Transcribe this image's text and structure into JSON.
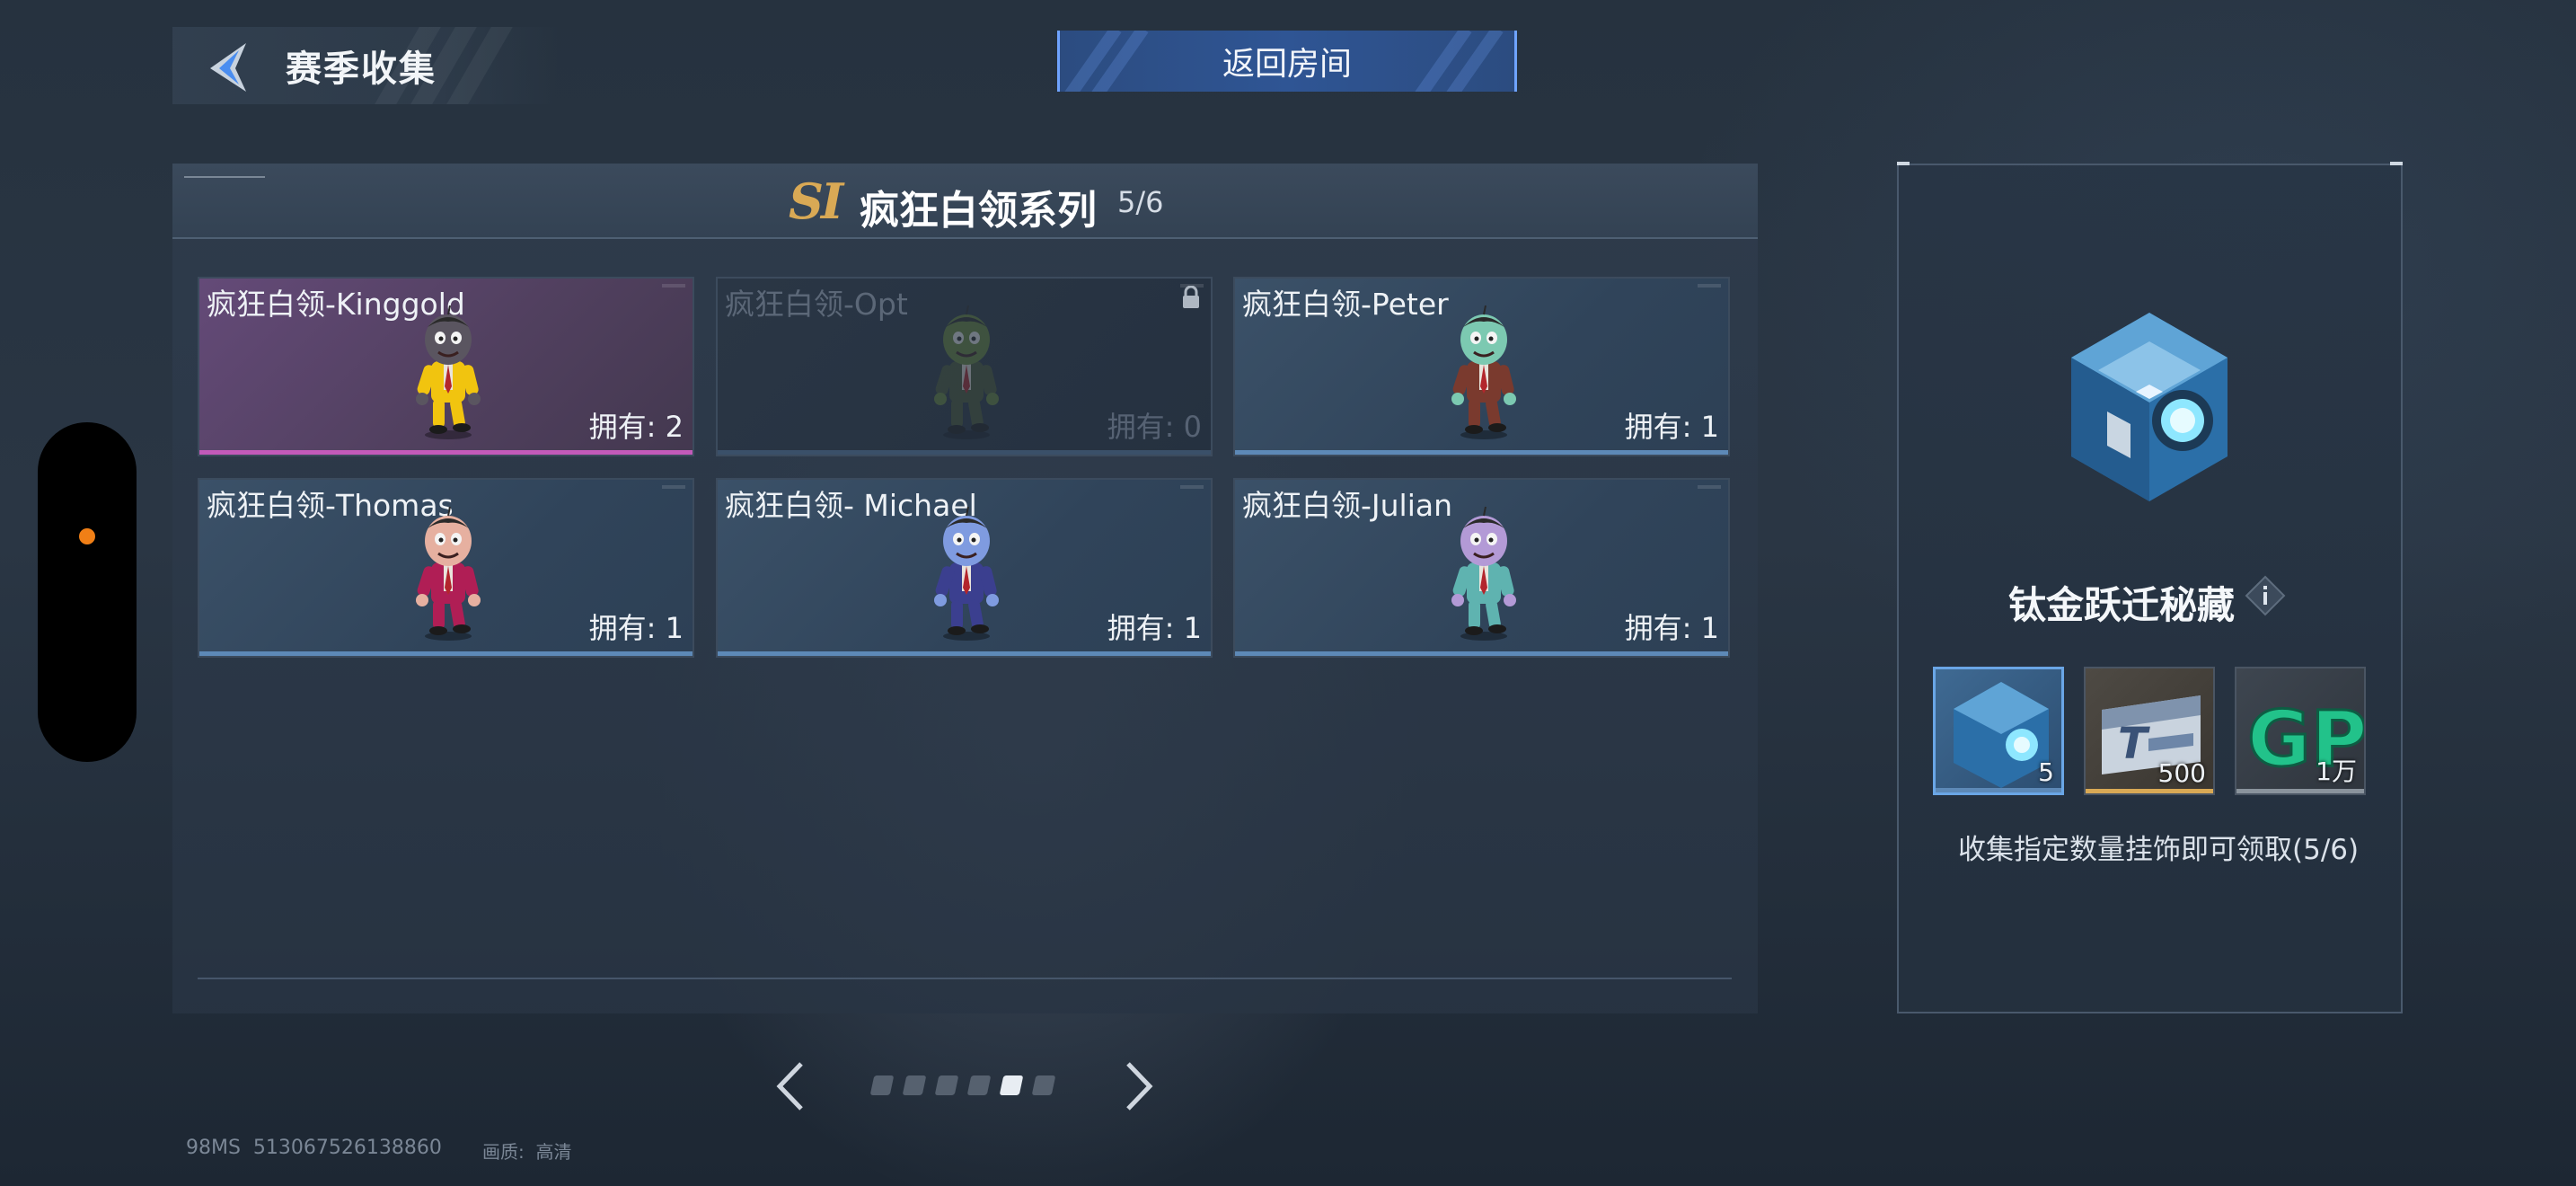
{
  "header": {
    "title": "赛季收集",
    "return_label": "返回房间"
  },
  "series": {
    "logo": "SI",
    "name": "疯狂白领系列",
    "progress": "5/6"
  },
  "cards": [
    {
      "name": "疯狂白领-Kinggold",
      "owned": "拥有: 2",
      "rarity": "purple",
      "locked": false,
      "skin": "#5a5560",
      "suit": "#f1c40f"
    },
    {
      "name": "疯狂白领-Opt",
      "owned": "拥有: 0",
      "rarity": "blue",
      "locked": true,
      "skin": "#6a8a3a",
      "suit": "#4a5a35"
    },
    {
      "name": "疯狂白领-Peter",
      "owned": "拥有: 1",
      "rarity": "blue",
      "locked": false,
      "skin": "#7cc9b1",
      "suit": "#7a3a2e"
    },
    {
      "name": "疯狂白领-Thomas",
      "owned": "拥有: 1",
      "rarity": "blue",
      "locked": false,
      "skin": "#e6b0a0",
      "suit": "#b01e55"
    },
    {
      "name": "疯狂白领- Michael",
      "owned": "拥有: 1",
      "rarity": "blue",
      "locked": false,
      "skin": "#7f9be0",
      "suit": "#3b3f8f"
    },
    {
      "name": "疯狂白领-Julian",
      "owned": "拥有: 1",
      "rarity": "blue",
      "locked": false,
      "skin": "#b39ad6",
      "suit": "#5fb3b0"
    }
  ],
  "pager": {
    "page_count": 6,
    "active_index": 4
  },
  "reward": {
    "name": "钛金跃迁秘藏",
    "items": [
      {
        "icon": "crate-icon",
        "qty": "5",
        "bar_color": "#5d89b7"
      },
      {
        "icon": "ticket-icon",
        "qty": "500",
        "bar_color": "#d9a955"
      },
      {
        "icon": "gp-icon",
        "qty": "1万",
        "bar_color": "#8a939c"
      }
    ],
    "description": "收集指定数量挂饰即可领取(5/6)"
  },
  "footer": {
    "status": "98MS  513067526138860",
    "quality": "画质:  高清"
  },
  "colors": {
    "accent_blue": "#6fa3ff",
    "rarity_purple": "#c25ab9",
    "rarity_blue": "#5d89b7",
    "gold": "#d9a955",
    "status_dot": "#f07f16"
  }
}
